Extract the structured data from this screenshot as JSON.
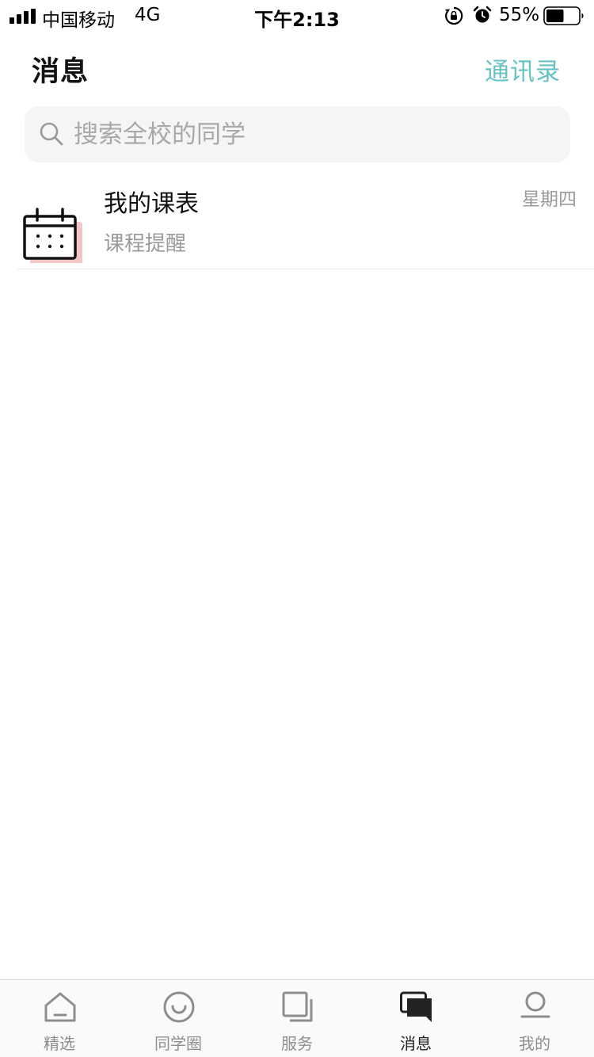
{
  "status_bar": {
    "carrier": "中国移动",
    "network": "4G",
    "time": "下午2:13",
    "battery_percent": "55%",
    "battery_level": 0.55,
    "icons": [
      "signal-bars-icon",
      "rotation-lock-icon",
      "alarm-icon",
      "battery-icon"
    ]
  },
  "header": {
    "title": "消息",
    "contacts_label": "通讯录"
  },
  "search": {
    "placeholder": "搜索全校的同学",
    "value": "",
    "icon": "search-icon"
  },
  "messages": [
    {
      "icon": "calendar-icon",
      "title": "我的课表",
      "subtitle": "课程提醒",
      "time": "星期四"
    }
  ],
  "tab_bar": {
    "tabs": [
      {
        "label": "精选",
        "icon": "home-icon",
        "active": false
      },
      {
        "label": "同学圈",
        "icon": "smile-icon",
        "active": false
      },
      {
        "label": "服务",
        "icon": "service-icon",
        "active": false
      },
      {
        "label": "消息",
        "icon": "chat-icon",
        "active": true
      },
      {
        "label": "我的",
        "icon": "profile-icon",
        "active": false
      }
    ]
  },
  "colors": {
    "accent": "#67c2c3",
    "tab_inactive": "#8d8d8d",
    "tab_active": "#222222",
    "calendar_shadow": "#f2c6c6"
  }
}
